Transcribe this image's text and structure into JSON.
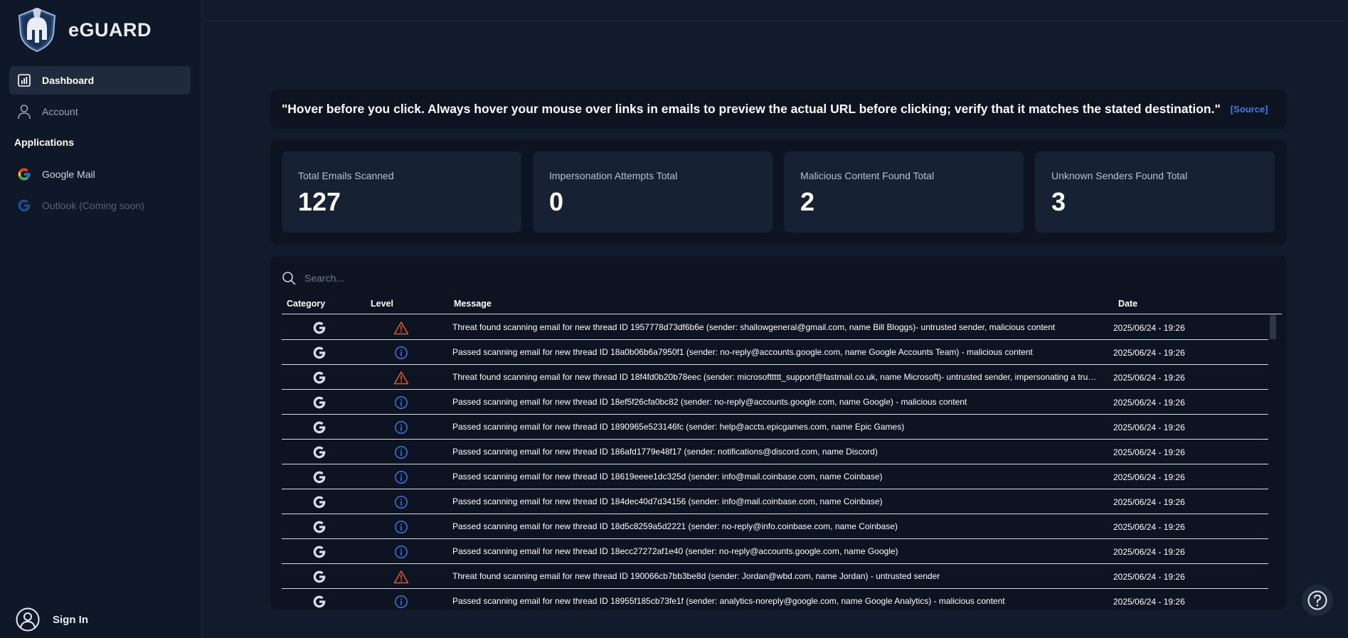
{
  "brand": {
    "name": "eGUARD",
    "logo_icon": "spartan-helmet-shield-icon"
  },
  "sidebar": {
    "items": [
      {
        "label": "Dashboard",
        "icon": "bar-chart-icon",
        "active": true
      },
      {
        "label": "Account",
        "icon": "user-icon",
        "active": false
      }
    ],
    "section_title": "Applications",
    "apps": [
      {
        "label": "Google Mail",
        "icon": "google-color-icon",
        "disabled": false
      },
      {
        "label": "Outlook (Coming soon)",
        "icon": "google-blue-icon",
        "disabled": true
      }
    ],
    "signin_label": "Sign In"
  },
  "quote": {
    "text": "\"Hover before you click. Always hover your mouse over links in emails to preview the actual URL before clicking; verify that it matches the stated destination.\"",
    "source_label": "[Source]"
  },
  "stats": [
    {
      "label": "Total Emails Scanned",
      "value": "127"
    },
    {
      "label": "Impersonation Attempts Total",
      "value": "0"
    },
    {
      "label": "Malicious Content Found Total",
      "value": "2"
    },
    {
      "label": "Unknown Senders Found Total",
      "value": "3"
    }
  ],
  "search": {
    "placeholder": "Search..."
  },
  "table": {
    "headers": {
      "category": "Category",
      "level": "Level",
      "message": "Message",
      "date": "Date"
    },
    "rows": [
      {
        "level": "warning",
        "message": "Threat found scanning email for new thread ID 1957778d73df6b6e (sender: shallowgeneral@gmail.com, name Bill Bloggs)- untrusted sender, malicious content",
        "date": "2025/06/24 - 19:26"
      },
      {
        "level": "info",
        "message": "Passed scanning email for new thread ID 18a0b06b6a7950f1 (sender: no-reply@accounts.google.com, name Google Accounts Team) - malicious content",
        "date": "2025/06/24 - 19:26"
      },
      {
        "level": "warning",
        "message": "Threat found scanning email for new thread ID 18f4fd0b20b78eec (sender: microsofttttt_support@fastmail.co.uk, name Microsoft)- untrusted sender, impersonating a trusted sender",
        "date": "2025/06/24 - 19:26"
      },
      {
        "level": "info",
        "message": "Passed scanning email for new thread ID 18ef5f26cfa0bc82 (sender: no-reply@accounts.google.com, name Google) - malicious content",
        "date": "2025/06/24 - 19:26"
      },
      {
        "level": "info",
        "message": "Passed scanning email for new thread ID 1890965e523146fc (sender: help@accts.epicgames.com, name Epic Games)",
        "date": "2025/06/24 - 19:26"
      },
      {
        "level": "info",
        "message": "Passed scanning email for new thread ID 186afd1779e48f17 (sender: notifications@discord.com, name Discord)",
        "date": "2025/06/24 - 19:26"
      },
      {
        "level": "info",
        "message": "Passed scanning email for new thread ID 18619eeee1dc325d (sender: info@mail.coinbase.com, name Coinbase)",
        "date": "2025/06/24 - 19:26"
      },
      {
        "level": "info",
        "message": "Passed scanning email for new thread ID 184dec40d7d34156 (sender: info@mail.coinbase.com, name Coinbase)",
        "date": "2025/06/24 - 19:26"
      },
      {
        "level": "info",
        "message": "Passed scanning email for new thread ID 18d5c8259a5d2221 (sender: no-reply@info.coinbase.com, name Coinbase)",
        "date": "2025/06/24 - 19:26"
      },
      {
        "level": "info",
        "message": "Passed scanning email for new thread ID 18ecc27272af1e40 (sender: no-reply@accounts.google.com, name Google)",
        "date": "2025/06/24 - 19:26"
      },
      {
        "level": "warning",
        "message": "Threat found scanning email for new thread ID 190066cb7bb3be8d (sender: Jordan@wbd.com, name Jordan) - untrusted sender",
        "date": "2025/06/24 - 19:26"
      },
      {
        "level": "info",
        "message": "Passed scanning email for new thread ID 18955f185cb73fe1f (sender: analytics-noreply@google.com, name Google Analytics) - malicious content",
        "date": "2025/06/24 - 19:26"
      }
    ]
  },
  "colors": {
    "warning": "#e8541e",
    "info": "#3b74e6",
    "accent": "#3d7bea"
  }
}
